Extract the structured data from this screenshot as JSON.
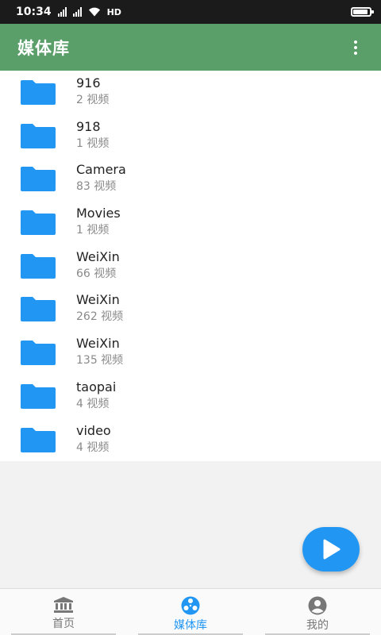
{
  "status_bar": {
    "time": "10:34",
    "network": "HD",
    "battery_level": 0.9
  },
  "app_bar": {
    "title": "媒体库",
    "menu_icon": "more-vert-icon"
  },
  "folders": [
    {
      "name": "916",
      "count": "2 视频"
    },
    {
      "name": "918",
      "count": "1 视频"
    },
    {
      "name": "Camera",
      "count": "83 视频"
    },
    {
      "name": "Movies",
      "count": "1 视频"
    },
    {
      "name": "WeiXin",
      "count": "66 视频"
    },
    {
      "name": "WeiXin",
      "count": "262 视频"
    },
    {
      "name": "WeiXin",
      "count": "135 视频"
    },
    {
      "name": "taopai",
      "count": "4 视频"
    },
    {
      "name": "video",
      "count": "4 视频"
    }
  ],
  "colors": {
    "app_bar": "#5a9e6a",
    "folder_icon": "#2196f3",
    "accent": "#2196f3"
  },
  "fab": {
    "icon": "play-icon"
  },
  "bottom_nav": {
    "tabs": [
      {
        "label": "首页",
        "icon": "bank-icon",
        "active": false
      },
      {
        "label": "媒体库",
        "icon": "film-reel-icon",
        "active": true
      },
      {
        "label": "我的",
        "icon": "account-icon",
        "active": false
      }
    ]
  }
}
